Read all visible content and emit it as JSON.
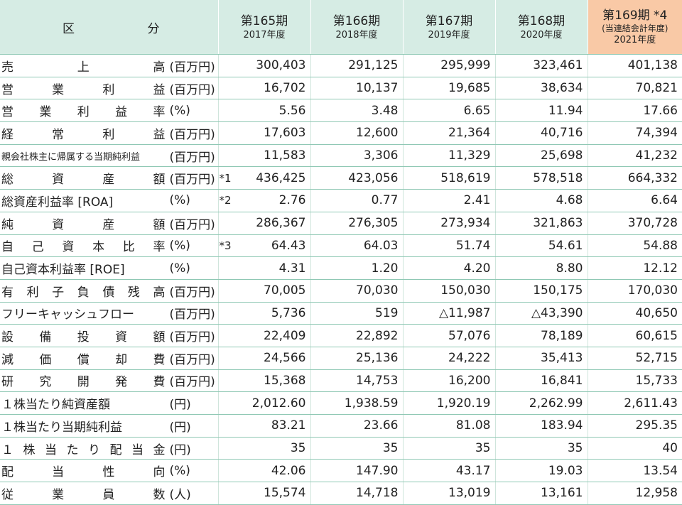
{
  "header": {
    "label_chars": [
      "区",
      "分"
    ],
    "columns": [
      {
        "title": "第165期",
        "sub": [
          "2017年度"
        ]
      },
      {
        "title": "第166期",
        "sub": [
          "2018年度"
        ]
      },
      {
        "title": "第167期",
        "sub": [
          "2019年度"
        ]
      },
      {
        "title": "第168期",
        "sub": [
          "2020年度"
        ]
      },
      {
        "title": "第169期 *4",
        "sub": [
          "(当連結会計年度)",
          "2021年度"
        ]
      }
    ]
  },
  "rows": [
    {
      "label": "売上高",
      "spread": true,
      "unit": "(百万円)",
      "mark": "",
      "values": [
        "300,403",
        "291,125",
        "295,999",
        "323,461",
        "401,138"
      ]
    },
    {
      "label": "営業利益",
      "spread": true,
      "unit": "(百万円)",
      "mark": "",
      "values": [
        "16,702",
        "10,137",
        "19,685",
        "38,634",
        "70,821"
      ]
    },
    {
      "label": "営業利益率",
      "spread": true,
      "unit": "(%)",
      "mark": "",
      "values": [
        "5.56",
        "3.48",
        "6.65",
        "11.94",
        "17.66"
      ]
    },
    {
      "label": "経常利益",
      "spread": true,
      "unit": "(百万円)",
      "mark": "",
      "values": [
        "17,603",
        "12,600",
        "21,364",
        "40,716",
        "74,394"
      ]
    },
    {
      "label": "親会社株主に帰属する当期純利益",
      "spread": false,
      "small": true,
      "unit": "(百万円)",
      "mark": "",
      "values": [
        "11,583",
        "3,306",
        "11,329",
        "25,698",
        "41,232"
      ]
    },
    {
      "label": "総資産額",
      "spread": true,
      "unit": "(百万円)",
      "mark": "*1",
      "values": [
        "436,425",
        "423,056",
        "518,619",
        "578,518",
        "664,332"
      ]
    },
    {
      "label": "総資産利益率 [ROA]",
      "spread": false,
      "unit": "(%)",
      "mark": "*2",
      "values": [
        "2.76",
        "0.77",
        "2.41",
        "4.68",
        "6.64"
      ]
    },
    {
      "label": "純資産額",
      "spread": true,
      "unit": "(百万円)",
      "mark": "",
      "values": [
        "286,367",
        "276,305",
        "273,934",
        "321,863",
        "370,728"
      ]
    },
    {
      "label": "自己資本比率",
      "spread": true,
      "unit": "(%)",
      "mark": "*3",
      "values": [
        "64.43",
        "64.03",
        "51.74",
        "54.61",
        "54.88"
      ]
    },
    {
      "label": "自己資本利益率 [ROE]",
      "spread": false,
      "unit": "(%)",
      "mark": "",
      "values": [
        "4.31",
        "1.20",
        "4.20",
        "8.80",
        "12.12"
      ]
    },
    {
      "label": "有利子負債残高",
      "spread": true,
      "unit": "(百万円)",
      "mark": "",
      "values": [
        "70,005",
        "70,030",
        "150,030",
        "150,175",
        "170,030"
      ]
    },
    {
      "label": "フリーキャッシュフロー",
      "spread": false,
      "unit": "(百万円)",
      "mark": "",
      "values": [
        "5,736",
        "519",
        "△11,987",
        "△43,390",
        "40,650"
      ]
    },
    {
      "label": "設備投資額",
      "spread": true,
      "unit": "(百万円)",
      "mark": "",
      "values": [
        "22,409",
        "22,892",
        "57,076",
        "78,189",
        "60,615"
      ]
    },
    {
      "label": "減価償却費",
      "spread": true,
      "unit": "(百万円)",
      "mark": "",
      "values": [
        "24,566",
        "25,136",
        "24,222",
        "35,413",
        "52,715"
      ]
    },
    {
      "label": "研究開発費",
      "spread": true,
      "unit": "(百万円)",
      "mark": "",
      "values": [
        "15,368",
        "14,753",
        "16,200",
        "16,841",
        "15,733"
      ]
    },
    {
      "label": "１株当たり純資産額",
      "spread": false,
      "unit": "(円)",
      "mark": "",
      "values": [
        "2,012.60",
        "1,938.59",
        "1,920.19",
        "2,262.99",
        "2,611.43"
      ]
    },
    {
      "label": "１株当たり当期純利益",
      "spread": false,
      "unit": "(円)",
      "mark": "",
      "values": [
        "83.21",
        "23.66",
        "81.08",
        "183.94",
        "295.35"
      ]
    },
    {
      "label": "１株当たり配当金",
      "spread": true,
      "unit": "(円)",
      "mark": "",
      "values": [
        "35",
        "35",
        "35",
        "35",
        "40"
      ]
    },
    {
      "label": "配当性向",
      "spread": true,
      "unit": "(%)",
      "mark": "",
      "values": [
        "42.06",
        "147.90",
        "43.17",
        "19.03",
        "13.54"
      ]
    },
    {
      "label": "従業員数",
      "spread": true,
      "unit": "(人)",
      "mark": "",
      "values": [
        "15,574",
        "14,718",
        "13,019",
        "13,161",
        "12,958"
      ]
    }
  ]
}
